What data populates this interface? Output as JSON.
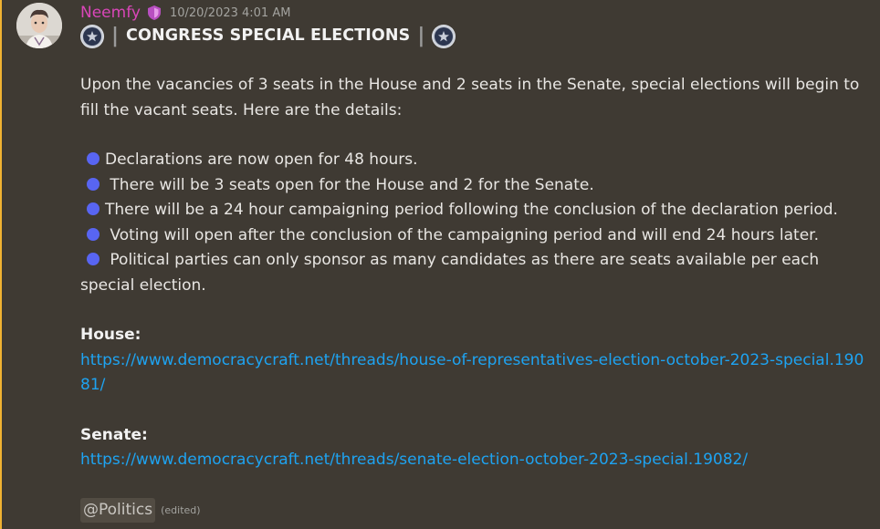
{
  "message": {
    "author": "Neemfy",
    "timestamp": "10/20/2023 4:01 AM",
    "title_pipe": "|",
    "title": "CONGRESS SPECIAL ELECTIONS",
    "intro": "Upon the vacancies of 3 seats in the House and 2 seats in the Senate, special elections will begin to fill the vacant seats. Here are the details:",
    "bullets": [
      "Declarations are now open for 48 hours.",
      " There will be 3 seats open for the House and 2 for the Senate.",
      "There will be a 24 hour campaigning period following the conclusion of the declaration period.",
      " Voting will open after the conclusion of the campaigning period and will end 24 hours later.",
      " Political parties can only sponsor as many candidates as there are seats available per each special election."
    ],
    "house_label": "House:",
    "house_link": "https://www.democracycraft.net/threads/house-of-representatives-election-october-2023-special.19081/",
    "senate_label": "Senate:",
    "senate_link": "https://www.democracycraft.net/threads/senate-election-october-2023-special.19082/",
    "mention": "@Politics",
    "edited": "(edited)"
  },
  "colors": {
    "username": "#d946b8",
    "link": "#1ea3f1",
    "bullet": "#5865f2",
    "background": "#3f3a33"
  },
  "icons": {
    "role": "shield-icon",
    "emblem": "star-seal-icon",
    "bullet": "blue-circle-icon"
  }
}
